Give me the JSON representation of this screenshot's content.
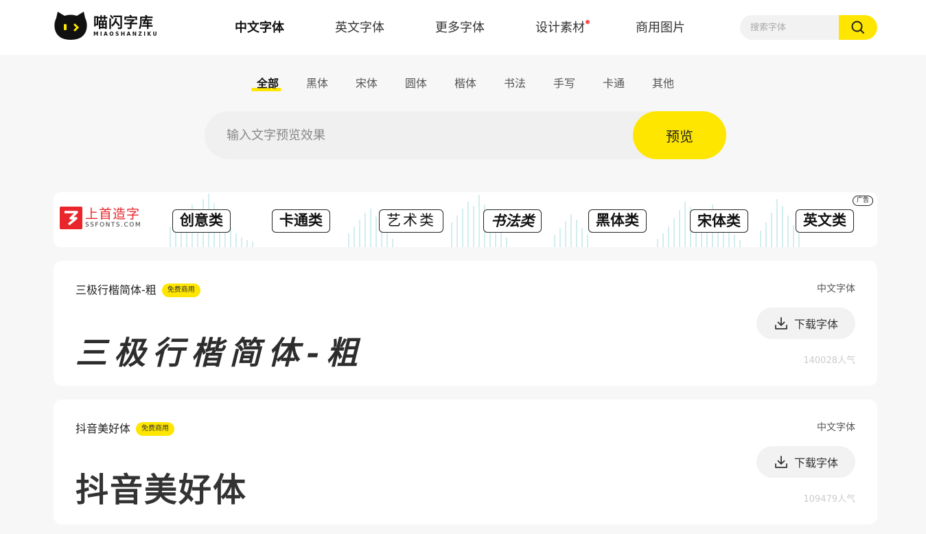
{
  "header": {
    "logo_name": "喵闪字库",
    "logo_sub": "MIAOSHANZIKU",
    "nav": [
      {
        "label": "中文字体",
        "active": true
      },
      {
        "label": "英文字体",
        "active": false
      },
      {
        "label": "更多字体",
        "active": false
      },
      {
        "label": "设计素材",
        "active": false,
        "dot": true
      },
      {
        "label": "商用图片",
        "active": false
      }
    ],
    "search_placeholder": "搜索字体",
    "search_icon": "search-icon"
  },
  "categories": [
    "全部",
    "黑体",
    "宋体",
    "圆体",
    "楷体",
    "书法",
    "手写",
    "卡通",
    "其他"
  ],
  "preview": {
    "placeholder": "输入文字预览效果",
    "button": "预览"
  },
  "ad": {
    "logo_name": "上首造字",
    "logo_sub": "SSFONTS.COM",
    "tags": [
      "创意类",
      "卡通类",
      "艺术类",
      "书法类",
      "黑体类",
      "宋体类",
      "英文类"
    ],
    "badge": "广告"
  },
  "fonts": [
    {
      "name": "三极行楷简体-粗",
      "badge": "免费商用",
      "category": "中文字体",
      "preview": "三极行楷简体-粗",
      "download": "下载字体",
      "popularity": "140028人气"
    },
    {
      "name": "抖音美好体",
      "badge": "免费商用",
      "category": "中文字体",
      "preview": "抖音美好体",
      "download": "下载字体",
      "popularity": "109479人气"
    }
  ],
  "colors": {
    "accent": "#ffe600",
    "ad_red": "#e8262b",
    "dot_red": "#ff4d4f"
  }
}
